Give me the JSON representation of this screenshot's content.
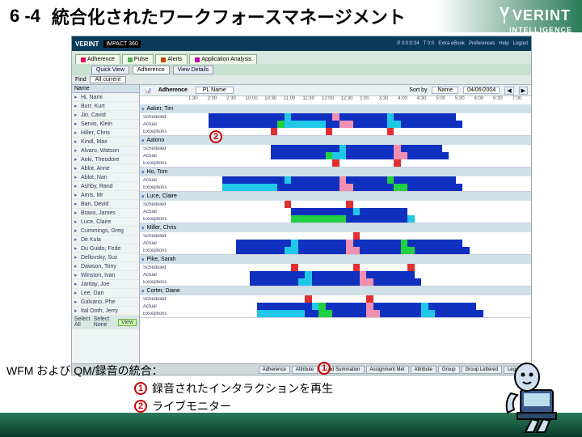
{
  "slide": {
    "number": "6 -4",
    "title": "統合化されたワークフォースマネージメント",
    "brand": "VERINT",
    "brand_tag": "INTELLIGENCE"
  },
  "app": {
    "logo": "VERINT",
    "product": "IMPACT 360",
    "top_menu": [
      "P 0:0:0:34",
      "T 0:0",
      "Extra eBook",
      "Preferences",
      "Help",
      "Logout"
    ],
    "tabs": [
      "Adherence",
      "Pulse",
      "Alerts",
      "Application Analysis"
    ],
    "subtabs": [
      "Quick View",
      "Adherence",
      "View Details"
    ],
    "subtab_selected": 1,
    "find_label": "Find",
    "find_value": "All current",
    "left_header": "Name",
    "employees": [
      "Hi, Nami",
      "Burr, Kurt",
      "Jio, Cavid",
      "Servis, Klein",
      "Hiller, Chris",
      "Kindl, Max",
      "Alvaro, Watson",
      "Aoki, Theodore",
      "Ablot, Anne",
      "Ablot, Nan",
      "Ashby, Rand",
      "Amis, Mr",
      "Ban, Devid",
      "Bravo, James",
      "Luce, Claire",
      "Cummings, Greg",
      "De Kula",
      "Du Guido, Fede",
      "Dellovsky, Suz",
      "Dawson, Tony",
      "Winston, Ivan",
      "Jantay, Joe",
      "Lee, Dan",
      "Galvano, Phe",
      "Ital Ooth, Jerry"
    ],
    "detail_header": "Adherence",
    "person_field": "PL Name",
    "sort_label": "Sort by",
    "sort_value": "Name",
    "date": "04/06/2004",
    "timeline": [
      "1:30",
      "2:00",
      "2:30",
      "10:00",
      "10:30",
      "11:00",
      "11:30",
      "12:00",
      "12:30",
      "1:00",
      "3:30",
      "4:00",
      "4:30",
      "5:00",
      "5:30",
      "6:00",
      "6:30",
      "7:00"
    ],
    "rows": [
      {
        "name": "Aaker, Tim",
        "lines": [
          "Scheduled",
          "Actual",
          "Exceptions"
        ]
      },
      {
        "name": "Aalono",
        "lines": [
          "Scheduled",
          "Actual",
          "Exceptions"
        ]
      },
      {
        "name": "Ho, Tom",
        "lines": [
          "Actual",
          "Exceptions"
        ]
      },
      {
        "name": "Luce, Claire",
        "lines": [
          "Scheduled",
          "Actual",
          "Exceptions"
        ]
      },
      {
        "name": "Miller, Chris",
        "lines": [
          "Scheduled",
          "Actual",
          "Exceptions"
        ]
      },
      {
        "name": "Pike, Sarah",
        "lines": [
          "Scheduled",
          "Actual",
          "Exceptions"
        ]
      },
      {
        "name": "Corter, Diane",
        "lines": [
          "Scheduled",
          "Actual",
          "Exceptions"
        ]
      }
    ],
    "footer_buttons": [
      "Adherence",
      "Attribute",
      "Load Summation",
      "Assignment Met",
      "Attribute",
      "Group",
      "Group Lettered",
      "Legend"
    ],
    "bottom_left": [
      "Select All",
      "Select None",
      "View"
    ]
  },
  "callouts": {
    "c1": "1",
    "c2": "2"
  },
  "caption": {
    "title": "WFM および QM/録音の統合：",
    "item1_num": "1",
    "item1": "録音されたインタラクションを再生",
    "item2_num": "2",
    "item2": "ライブモニター"
  }
}
